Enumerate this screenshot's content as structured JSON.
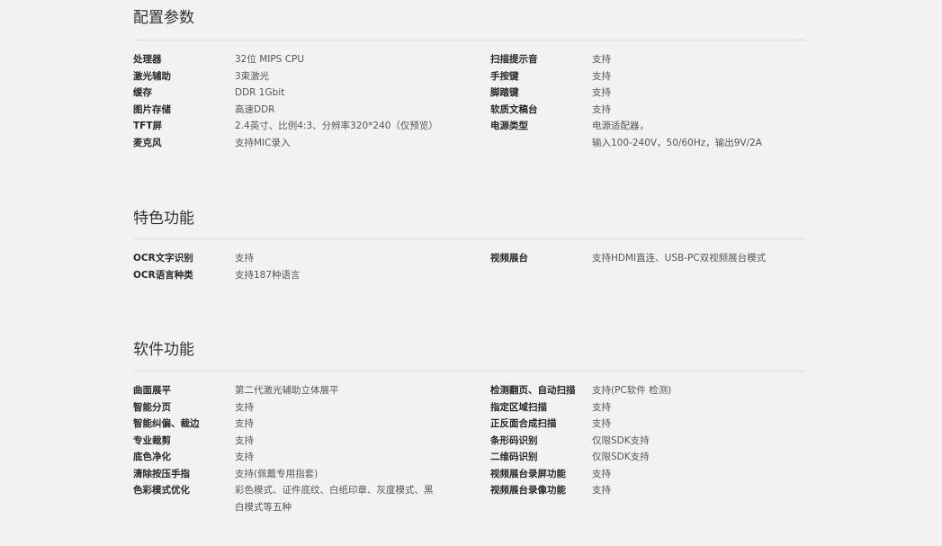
{
  "sections": [
    {
      "title": "配置参数",
      "left": [
        {
          "label": "处理器",
          "value": "32位 MIPS CPU"
        },
        {
          "label": "激光辅助",
          "value": "3束激光"
        },
        {
          "label": "缓存",
          "value": "DDR 1Gbit"
        },
        {
          "label": "图片存储",
          "value": "高速DDR"
        },
        {
          "label": "TFT屏",
          "value": "2.4英寸、比例4:3、分辨率320*240（仅预览）"
        },
        {
          "label": "麦克风",
          "value": "支持MIC录入"
        }
      ],
      "right": [
        {
          "label": "扫描提示音",
          "value": "支持"
        },
        {
          "label": "手按键",
          "value": "支持"
        },
        {
          "label": "脚踏键",
          "value": "支持"
        },
        {
          "label": "软质文稿台",
          "value": "支持"
        },
        {
          "label": "电源类型",
          "value_lines": [
            "电源适配器，",
            "输入100-240V，50/60Hz，输出9V/2A"
          ]
        }
      ]
    },
    {
      "title": "特色功能",
      "left": [
        {
          "label": "OCR文字识别",
          "value": "支持"
        },
        {
          "label": "OCR语言种类",
          "value": "支持187种语言"
        }
      ],
      "right": [
        {
          "label": "视频展台",
          "value": "支持HDMI直连、USB-PC双视频展台模式"
        }
      ]
    },
    {
      "title": "软件功能",
      "left": [
        {
          "label": "曲面展平",
          "value": "第二代激光辅助立体展平"
        },
        {
          "label": "智能分页",
          "value": "支持"
        },
        {
          "label": "智能纠偏、裁边",
          "value": "支持"
        },
        {
          "label": "专业裁剪",
          "value": "支持"
        },
        {
          "label": "底色净化",
          "value": "支持"
        },
        {
          "label": "清除按压手指",
          "value": "支持(佩戴专用指套)"
        },
        {
          "label": "色彩模式优化",
          "value_lines": [
            "彩色模式、证件底纹、白纸印章、灰度模式、黑",
            "白模式等五种"
          ]
        }
      ],
      "right": [
        {
          "label": "检测翻页、自动扫描",
          "value": "支持(PC软件 检测)"
        },
        {
          "label": "指定区域扫描",
          "value": "支持"
        },
        {
          "label": "正反面合成扫描",
          "value": "支持"
        },
        {
          "label": "条形码识别",
          "value": "仅限SDK支持"
        },
        {
          "label": "二维码识别",
          "value": "仅限SDK支持"
        },
        {
          "label": "视频展台录屏功能",
          "value": "支持"
        },
        {
          "label": "视频展台录像功能",
          "value": "支持"
        }
      ]
    }
  ]
}
